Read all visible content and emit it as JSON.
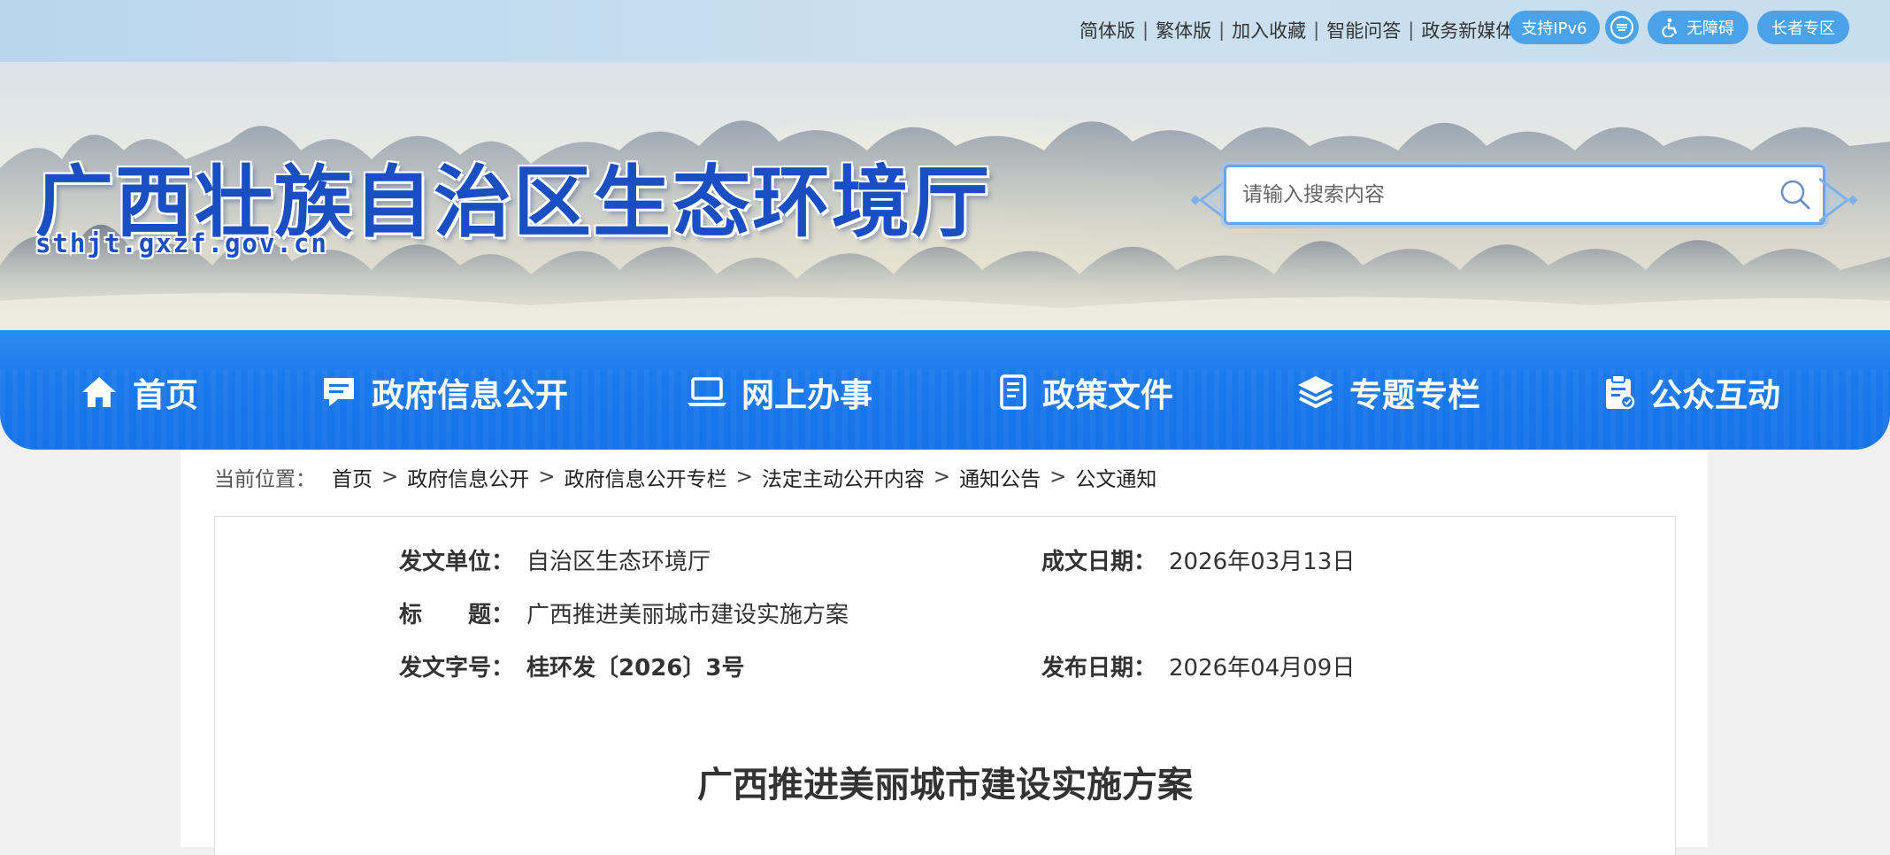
{
  "topbar": {
    "links": [
      "简体版",
      "繁体版",
      "加入收藏",
      "智能问答",
      "政务新媒体"
    ],
    "separator": "|",
    "ipv6": "支持IPv6",
    "care_mode": "无障碍",
    "elder_zone": "长者专区"
  },
  "banner": {
    "title": "广西壮族自治区生态环境厅",
    "domain": "sthjt.gxzf.gov.cn"
  },
  "search": {
    "placeholder": "请输入搜索内容"
  },
  "nav": {
    "items": [
      {
        "label": "首页",
        "icon": "home-icon"
      },
      {
        "label": "政府信息公开",
        "icon": "message-icon"
      },
      {
        "label": "网上办事",
        "icon": "laptop-icon"
      },
      {
        "label": "政策文件",
        "icon": "document-icon"
      },
      {
        "label": "专题专栏",
        "icon": "layers-icon"
      },
      {
        "label": "公众互动",
        "icon": "clipboard-icon"
      }
    ]
  },
  "breadcrumb": {
    "label": "当前位置：",
    "items": [
      "首页",
      "政府信息公开",
      "政府信息公开专栏",
      "法定主动公开内容",
      "通知公告",
      "公文通知"
    ],
    "separator": ">"
  },
  "meta": {
    "issuer_label": "发文单位：",
    "issuer": "自治区生态环境厅",
    "date_written_label": "成文日期：",
    "date_written": "2026年03月13日",
    "title_label": "标　　题：",
    "title": "广西推进美丽城市建设实施方案",
    "doc_no_label": "发文字号：",
    "doc_no": "桂环发〔2026〕3号",
    "publish_date_label": "发布日期：",
    "publish_date": "2026年04月09日"
  },
  "article": {
    "title": "广西推进美丽城市建设实施方案"
  }
}
